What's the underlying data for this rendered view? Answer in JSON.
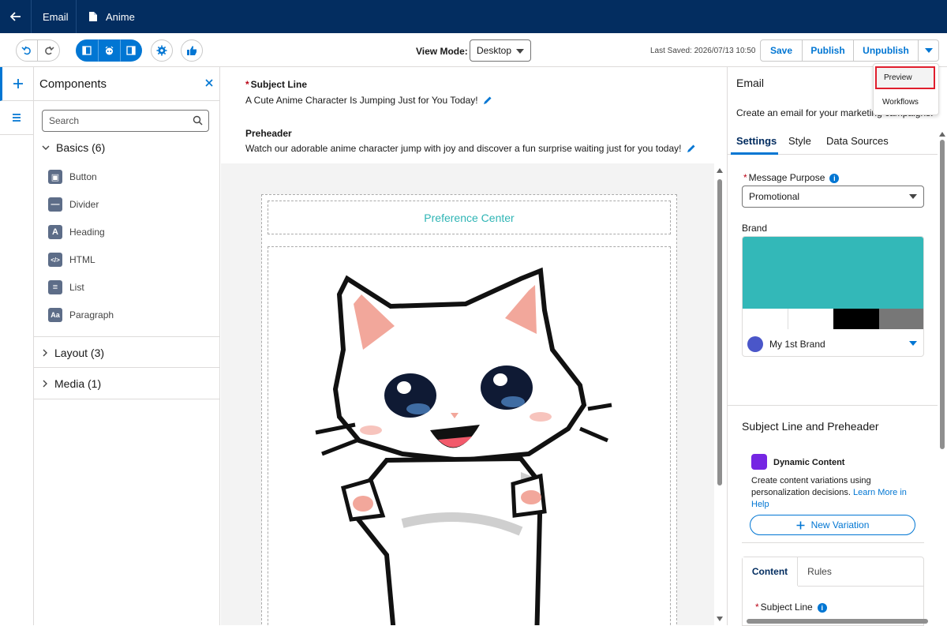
{
  "topbar": {
    "email": "Email",
    "doc": "Anime"
  },
  "toolbar": {
    "view_mode_label": "View Mode:",
    "view_mode_value": "Desktop",
    "last_saved": "Last Saved: 2026/07/13 10:50",
    "save": "Save",
    "publish": "Publish",
    "unpublish": "Unpublish"
  },
  "menu": {
    "items": [
      "Preview",
      "Workflows"
    ]
  },
  "components": {
    "title": "Components",
    "search_placeholder": "Search",
    "basics": "Basics (6)",
    "items": [
      "Button",
      "Divider",
      "Heading",
      "HTML",
      "List",
      "Paragraph"
    ],
    "layout": "Layout (3)",
    "media": "Media (1)"
  },
  "email_fields": {
    "subject_label": "Subject Line",
    "subject_value": "A Cute Anime Character Is Jumping Just for You Today!",
    "preheader_label": "Preheader",
    "preheader_value": "Watch our adorable anime character jump with joy and discover a fun surprise waiting just for you today!"
  },
  "canvas": {
    "preference_center": "Preference Center"
  },
  "right_panel": {
    "title": "Email",
    "description": "Create an email for your marketing campaigns.",
    "tabs": [
      "Settings",
      "Style",
      "Data Sources"
    ],
    "message_purpose_label": "Message Purpose",
    "message_purpose_value": "Promotional",
    "brand_label": "Brand",
    "brand_name": "My 1st Brand",
    "brand_colors": [
      "#33b8b8",
      "#ffffff",
      "#ffffff",
      "#000000",
      "#777777"
    ],
    "subject_section": "Subject Line and Preheader",
    "dynamic_title": "Dynamic Content",
    "dynamic_desc": "Create content variations using personalization decisions.",
    "learn_more": "Learn More in Help",
    "new_variation": "New Variation",
    "content_tab": "Content",
    "rules_tab": "Rules",
    "subject_line_label": "Subject Line"
  },
  "colors": {
    "nav": "#032d60",
    "accent": "#0176d3",
    "highlight": "#e01e2d"
  }
}
